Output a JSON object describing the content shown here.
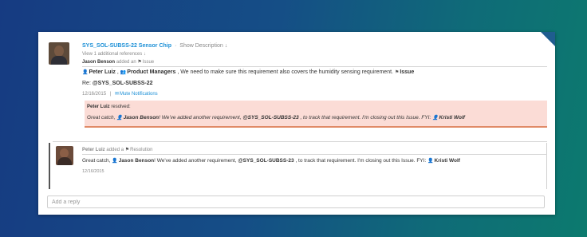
{
  "post": {
    "title": "SYS_SOL-SUBSS-22 Sensor Chip",
    "separator": "·",
    "show_description": "Show Description ↓",
    "additional_refs": "View 1 additional references ↓",
    "author": "Jason Benson",
    "action": "added an",
    "type_label": "Issue",
    "mention_user": "Peter Luiz",
    "mention_group": "Product Managers",
    "message": ", We need to make sure this requirement also covers the humidity sensing requirement.",
    "message_tag": "Issue",
    "re_prefix": "Re:",
    "re_ref": "@SYS_SOL-SUBSS-22",
    "date": "12/16/2015",
    "mute_label": "Mute Notifications"
  },
  "resolved_box": {
    "author": "Peter Luiz",
    "status": "resolved:",
    "text_1": "Great catch,",
    "mention_1": "Jason Benson",
    "text_2": "! We've added another requirement,",
    "ref": "@SYS_SOL-SUBSS-23",
    "text_3": ", to track that requirement. I'm closing out this Issue. FYI:",
    "mention_2": "Kristi Wolf"
  },
  "comment": {
    "author": "Peter Luiz",
    "action": "added a",
    "type_label": "Resolution",
    "text_1": "Great catch,",
    "mention_1": "Jason Benson",
    "text_2": "! We've added another requirement,",
    "ref": "@SYS_SOL-SUBSS-23",
    "text_3": ", to track that requirement. I'm closing out this Issue. FYI:",
    "mention_2": "Kristi Wolf",
    "date": "12/16/2015"
  },
  "reply": {
    "placeholder": "Add a reply"
  }
}
